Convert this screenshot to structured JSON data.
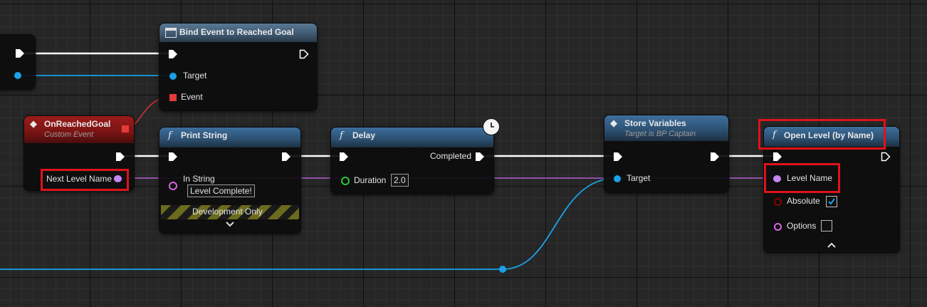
{
  "nodes": {
    "bind_event": {
      "title": "Bind Event to Reached Goal",
      "pins": {
        "target": "Target",
        "event": "Event"
      }
    },
    "on_reached_goal": {
      "title": "OnReachedGoal",
      "subtitle": "Custom Event",
      "pins": {
        "next_level_name": "Next Level Name"
      }
    },
    "print_string": {
      "title": "Print String",
      "pins": {
        "in_string": "In String"
      },
      "in_string_value": "Level Complete!",
      "dev_only": "Development Only"
    },
    "delay": {
      "title": "Delay",
      "pins": {
        "completed": "Completed",
        "duration": "Duration"
      },
      "duration_value": "2.0"
    },
    "store_variables": {
      "title": "Store Variables",
      "subtitle": "Target is BP Captain",
      "pins": {
        "target": "Target"
      }
    },
    "open_level": {
      "title": "Open Level (by Name)",
      "pins": {
        "level_name": "Level Name",
        "absolute": "Absolute",
        "options": "Options"
      },
      "absolute_checked": true,
      "options_checked": false
    }
  },
  "icons": {
    "function": "f",
    "expand": "chevron-down",
    "collapse": "chevron-up",
    "latent": "clock"
  },
  "colors": {
    "exec": "#ffffff",
    "object": "#1aa1e8",
    "string": "#d864e6",
    "delegate": "#e33a3a",
    "name": "#c885f2",
    "bool": "#8b0000",
    "highlight": "#e0121a"
  }
}
